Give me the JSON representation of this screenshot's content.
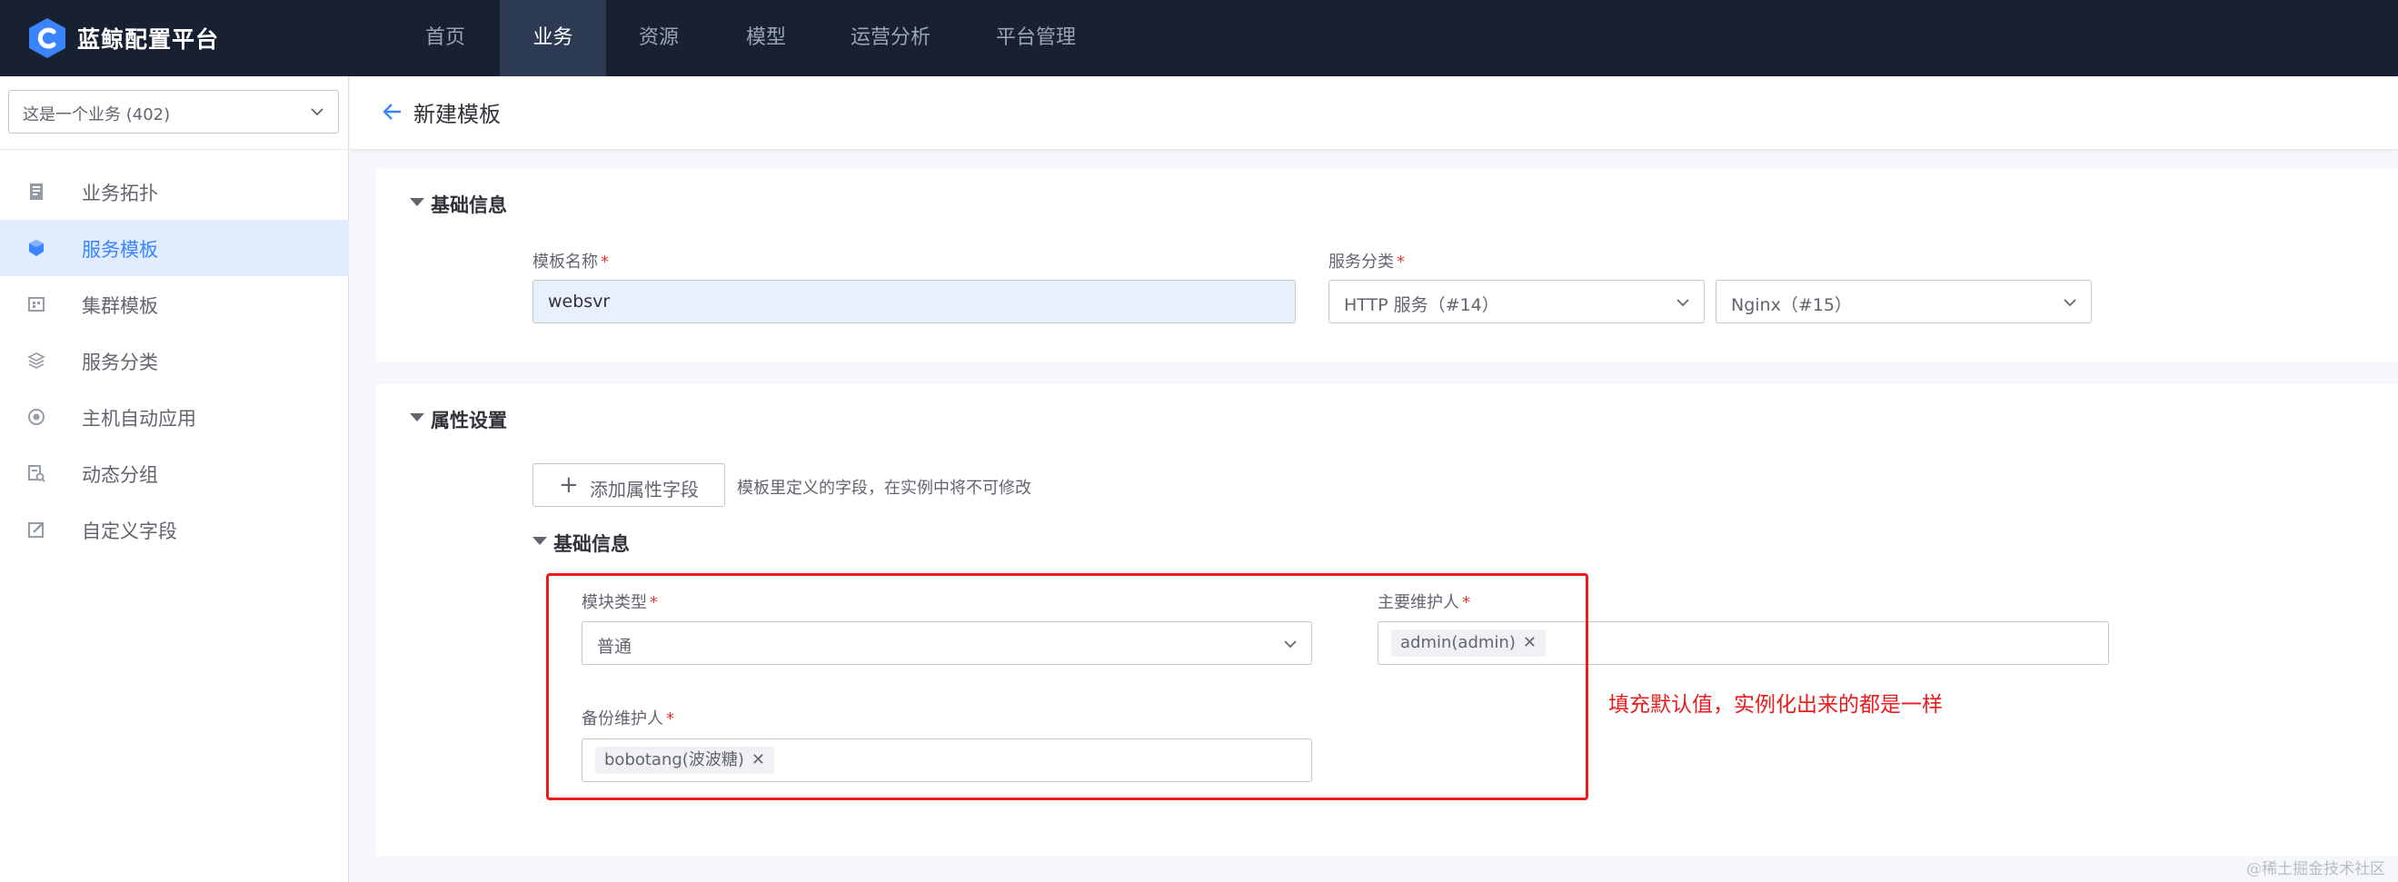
{
  "app": {
    "brand": "蓝鲸配置平台"
  },
  "nav": {
    "items": [
      {
        "label": "首页"
      },
      {
        "label": "业务"
      },
      {
        "label": "资源"
      },
      {
        "label": "模型"
      },
      {
        "label": "运营分析"
      },
      {
        "label": "平台管理"
      }
    ],
    "active": "业务"
  },
  "sidebar": {
    "business_select": "这是一个业务 (402)",
    "items": [
      {
        "label": "业务拓扑",
        "icon": "topology-icon"
      },
      {
        "label": "服务模板",
        "icon": "cube-icon",
        "active": true
      },
      {
        "label": "集群模板",
        "icon": "cluster-icon"
      },
      {
        "label": "服务分类",
        "icon": "layers-icon"
      },
      {
        "label": "主机自动应用",
        "icon": "auto-apply-icon"
      },
      {
        "label": "动态分组",
        "icon": "dynamic-group-icon"
      },
      {
        "label": "自定义字段",
        "icon": "edit-icon"
      }
    ]
  },
  "header": {
    "title": "新建模板"
  },
  "basic": {
    "title": "基础信息",
    "name_label": "模板名称",
    "name_value": "websvr",
    "category_label": "服务分类",
    "category_primary": "HTTP 服务（#14）",
    "category_secondary": "Nginx（#15）"
  },
  "attrs": {
    "title": "属性设置",
    "add_button": "添加属性字段",
    "hint": "模板里定义的字段，在实例中将不可修改",
    "group_title": "基础信息",
    "module_type_label": "模块类型",
    "module_type_value": "普通",
    "maintainer_label": "主要维护人",
    "maintainer_tag": "admin(admin)",
    "backup_label": "备份维护人",
    "backup_tag": "bobotang(波波糖)"
  },
  "annotation": "填充默认值，实例化出来的都是一样",
  "watermark": "@稀土掘金技术社区",
  "colors": {
    "accent": "#3a84ff",
    "topbar": "#182132",
    "annotation": "#ea1c1c"
  }
}
